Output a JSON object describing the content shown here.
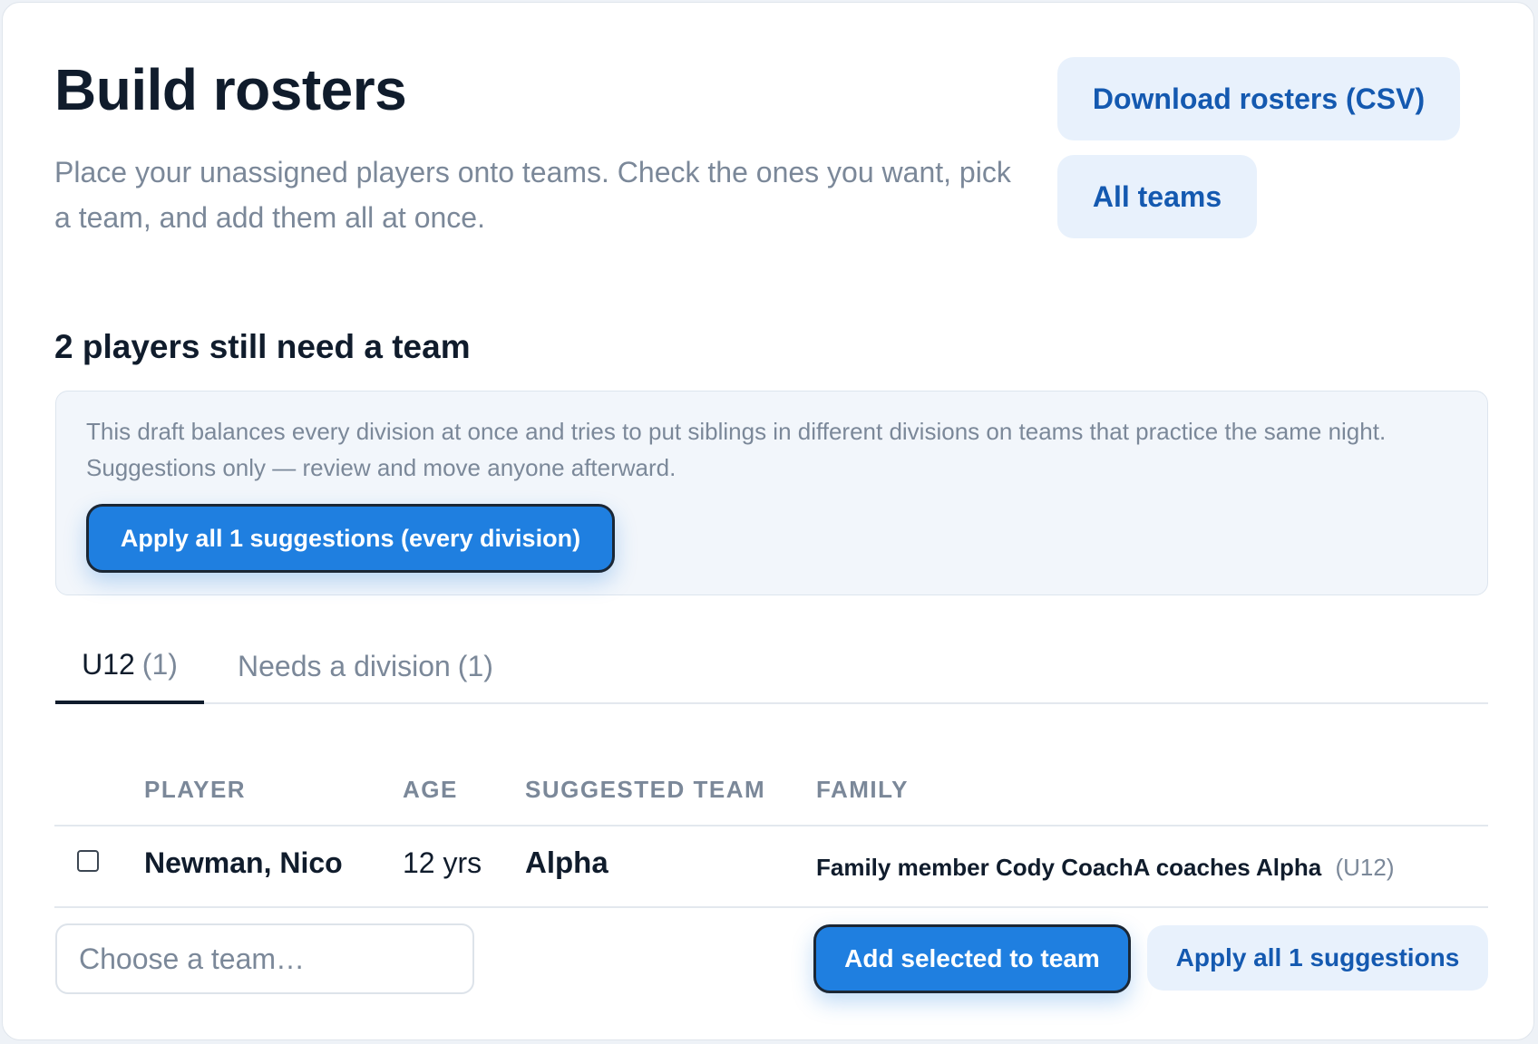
{
  "header": {
    "title": "Build rosters",
    "subtitle": "Place your unassigned players onto teams. Check the ones you want, pick a team, and add them all at once.",
    "download_label": "Download rosters (CSV)",
    "all_teams_label": "All teams"
  },
  "section": {
    "heading": "2 players still need a team"
  },
  "info_box": {
    "text": "This draft balances every division at once and tries to put siblings in different divisions on teams that practice the same night. Suggestions only — review and move anyone afterward.",
    "apply_all_label": "Apply all 1 suggestions (every division)"
  },
  "tabs": [
    {
      "label": "U12",
      "count": "(1)",
      "active": true
    },
    {
      "label": "Needs a division",
      "count": "(1)",
      "active": false
    }
  ],
  "table": {
    "columns": [
      "PLAYER",
      "AGE",
      "SUGGESTED TEAM",
      "FAMILY"
    ],
    "rows": [
      {
        "checked": false,
        "player": "Newman, Nico",
        "age": "12 yrs",
        "suggested_team": "Alpha",
        "family": "Family member Cody CoachA coaches Alpha",
        "family_division": "(U12)"
      }
    ]
  },
  "footer": {
    "team_select_placeholder": "Choose a team…",
    "add_selected_label": "Add selected to team",
    "apply_suggestions_label": "Apply all 1 suggestions"
  },
  "colors": {
    "primary": "#1f7fe0",
    "soft_button_bg": "#e8f1fc",
    "soft_button_text": "#1459b0",
    "heading": "#101c2c",
    "muted": "#7b8899"
  }
}
